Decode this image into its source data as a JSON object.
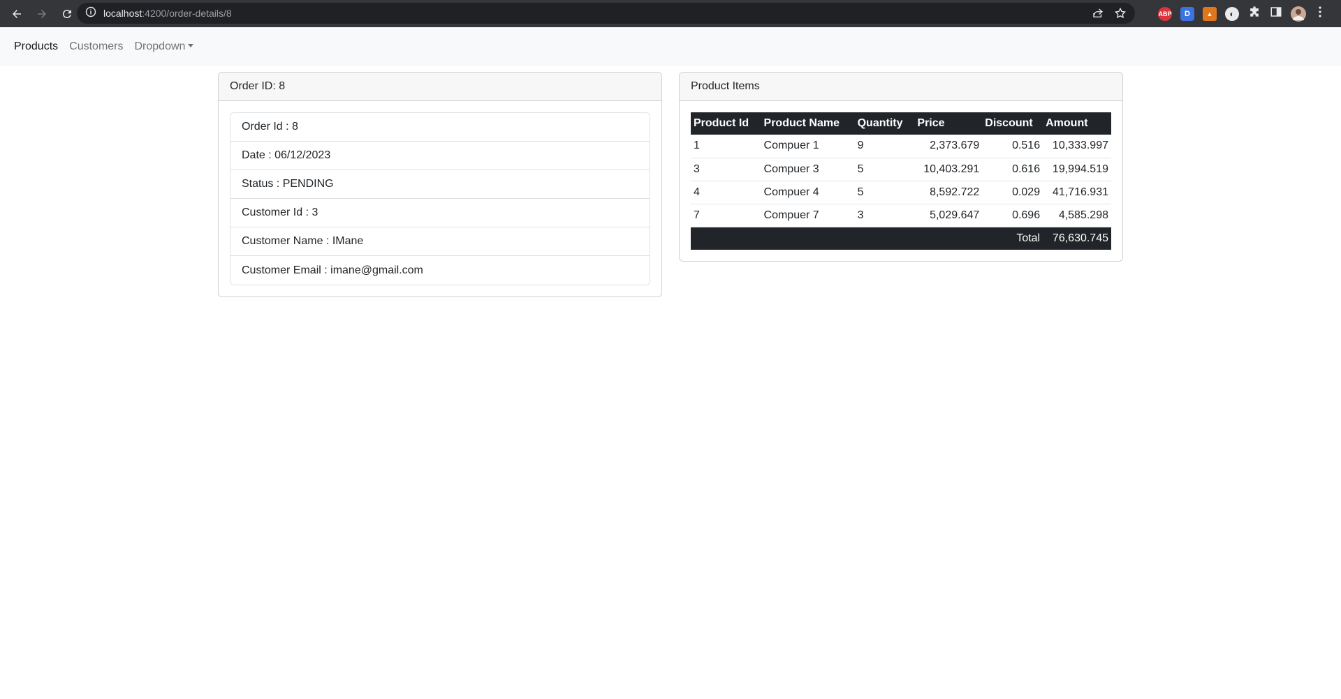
{
  "browser": {
    "url_host": "localhost",
    "url_path": ":4200/order-details/8"
  },
  "navbar": {
    "products": "Products",
    "customers": "Customers",
    "dropdown": "Dropdown"
  },
  "order_card": {
    "header": "Order ID: 8",
    "items": [
      "Order Id : 8",
      "Date : 06/12/2023",
      "Status : PENDING",
      "Customer Id : 3",
      "Customer Name : IMane",
      "Customer Email : imane@gmail.com"
    ]
  },
  "products_card": {
    "header": "Product Items",
    "columns": [
      "Product Id",
      "Product Name",
      "Quantity",
      "Price",
      "Discount",
      "Amount"
    ],
    "rows": [
      [
        "1",
        "Compuer 1",
        "9",
        "2,373.679",
        "0.516",
        "10,333.997"
      ],
      [
        "3",
        "Compuer 3",
        "5",
        "10,403.291",
        "0.616",
        "19,994.519"
      ],
      [
        "4",
        "Compuer 4",
        "5",
        "8,592.722",
        "0.029",
        "41,716.931"
      ],
      [
        "7",
        "Compuer 7",
        "3",
        "5,029.647",
        "0.696",
        "4,585.298"
      ]
    ],
    "total_label": "Total",
    "total_value": "76,630.745"
  }
}
